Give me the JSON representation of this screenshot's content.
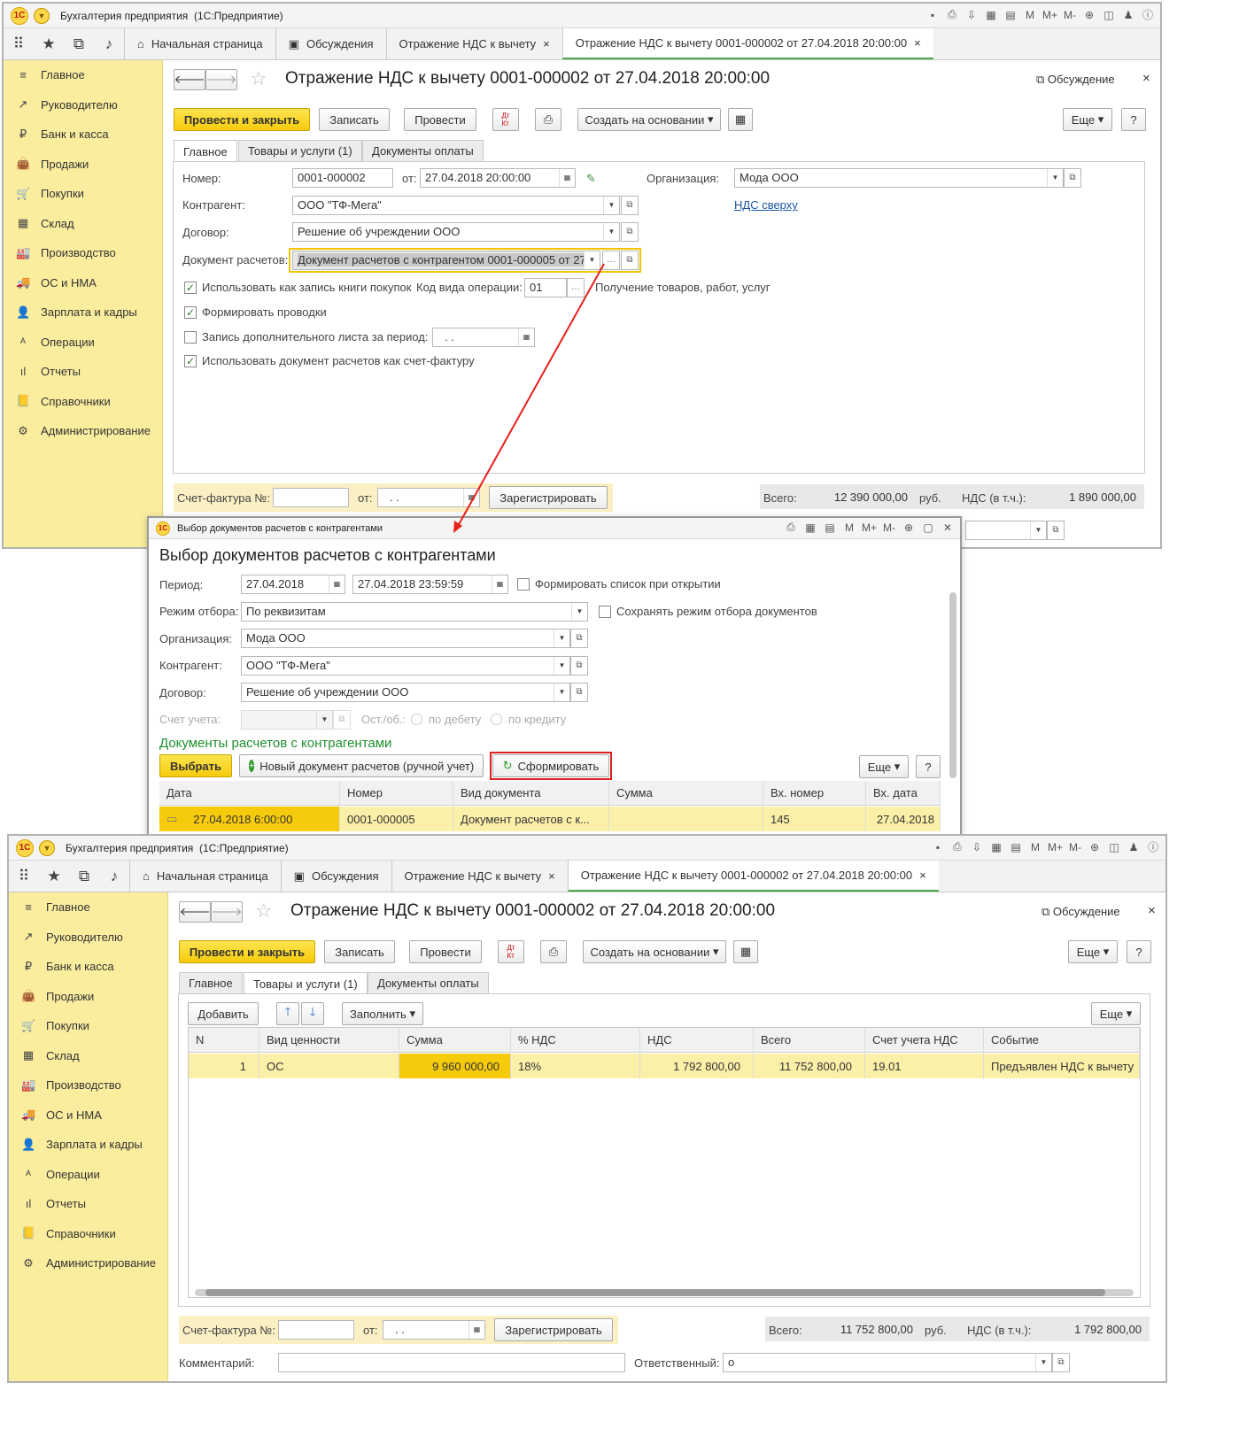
{
  "app": {
    "logo": "1С",
    "title": "Бухгалтерия предприятия",
    "subtitle": "(1С:Предприятие)"
  },
  "top_tabs": [
    {
      "label": "Начальная страница"
    },
    {
      "label": "Обсуждения"
    },
    {
      "label": "Отражение НДС к вычету"
    },
    {
      "label": "Отражение НДС к вычету 0001-000002 от 27.04.2018 20:00:00"
    }
  ],
  "sidebar": [
    "Главное",
    "Руководителю",
    "Банк и касса",
    "Продажи",
    "Покупки",
    "Склад",
    "Производство",
    "ОС и НМА",
    "Зарплата и кадры",
    "Операции",
    "Отчеты",
    "Справочники",
    "Администрирование"
  ],
  "doc": {
    "title": "Отражение НДС к вычету 0001-000002 от 27.04.2018 20:00:00",
    "discussion": "Обсуждение",
    "post_close": "Провести и закрыть",
    "save": "Записать",
    "post": "Провести",
    "create_based": "Создать на основании",
    "more": "Еще",
    "help": "?",
    "dtkt": "Дт Кт"
  },
  "form_tabs": [
    "Главное",
    "Товары и услуги (1)",
    "Документы оплаты"
  ],
  "main": {
    "number_label": "Номер:",
    "number": "0001-000002",
    "from_label": "от:",
    "date": "27.04.2018 20:00:00",
    "org_label": "Организация:",
    "org": "Мода ООО",
    "vat_link": "НДС сверху",
    "contragent_label": "Контрагент:",
    "contragent": "ООО \"ТФ-Мега\"",
    "contract_label": "Договор:",
    "contract": "Решение об учреждении ООО",
    "settle_label": "Документ расчетов:",
    "settle": "Документ расчетов с контрагентом 0001-000005 от 27",
    "use_book": "Использовать как запись книги покупок",
    "op_code_label": "Код вида операции:",
    "op_code": "01",
    "op_code_desc": "Получение товаров, работ, услуг",
    "postings": "Формировать проводки",
    "extra_sheet": "Запись дополнительного листа за период:",
    "period_empty": ". .",
    "use_as_invoice": "Использовать документ расчетов как счет-фактуру"
  },
  "footer": {
    "invoice_label": "Счет-фактура №:",
    "from_label": "от:",
    "date_empty": ". .",
    "register": "Зарегистрировать",
    "total_label": "Всего:",
    "total1": "12 390 000,00",
    "total2": "11 752 800,00",
    "rub": "руб.",
    "vat_label": "НДС (в т.ч.):",
    "vat1": "1 890 000,00",
    "vat2": "1 792 800,00",
    "comment_label": "Комментарий:",
    "resp_label": "Ответственный:",
    "resp": "о"
  },
  "dialog": {
    "wtitle": "Выбор документов расчетов с контрагентами",
    "title": "Выбор документов расчетов с контрагентами",
    "period_label": "Период:",
    "period_from": "27.04.2018",
    "period_to": "27.04.2018 23:59:59",
    "gen_on_open": "Формировать список при открытии",
    "mode_label": "Режим отбора:",
    "mode": "По реквизитам",
    "keep_mode": "Сохранять режим отбора документов",
    "org_label": "Организация:",
    "org": "Мода ООО",
    "contragent_label": "Контрагент:",
    "contragent": "ООО \"ТФ-Мега\"",
    "contract_label": "Договор:",
    "contract": "Решение об учреждении ООО",
    "account_label": "Счет учета:",
    "balance_label": "Ост./об.:",
    "debit": "по дебету",
    "credit": "по кредиту",
    "section": "Документы расчетов с контрагентами",
    "select": "Выбрать",
    "new_doc": "Новый документ расчетов (ручной учет)",
    "generate": "Сформировать",
    "more": "Еще",
    "help": "?",
    "columns": [
      "Дата",
      "Номер",
      "Вид документа",
      "Сумма",
      "Вх. номер",
      "Вх. дата"
    ],
    "row": [
      "27.04.2018 6:00:00",
      "0001-000005",
      "Документ расчетов с к...",
      "",
      "145",
      "27.04.2018"
    ]
  },
  "goods": {
    "add": "Добавить",
    "fill": "Заполнить",
    "more": "Еще",
    "columns": [
      "N",
      "Вид ценности",
      "Сумма",
      "% НДС",
      "НДС",
      "Всего",
      "Счет учета НДС",
      "Событие"
    ],
    "row": [
      "1",
      "ОС",
      "9 960 000,00",
      "18%",
      "1 792 800,00",
      "11 752 800,00",
      "19.01",
      "Предъявлен НДС к вычету"
    ]
  },
  "colors": {
    "accent_yellow": "#f6cb0c",
    "sidebar_bg": "#fbed9e",
    "highlight_red": "#d9231e",
    "link": "#1a56a0"
  }
}
